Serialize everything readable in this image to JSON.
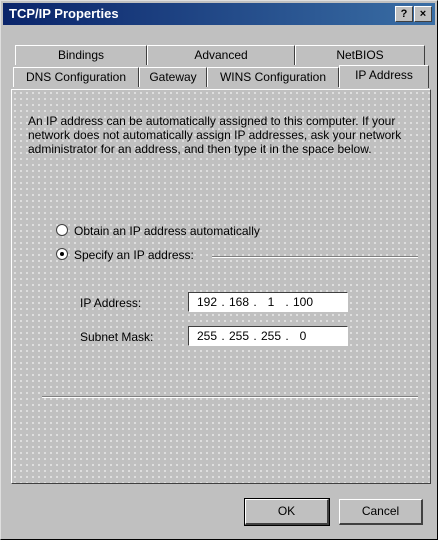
{
  "window": {
    "title": "TCP/IP Properties",
    "help_glyph": "?",
    "close_glyph": "×"
  },
  "tabs": {
    "row1": [
      "Bindings",
      "Advanced",
      "NetBIOS"
    ],
    "row2": [
      "DNS Configuration",
      "Gateway",
      "WINS Configuration",
      "IP Address"
    ],
    "active": "IP Address"
  },
  "description": "An IP address can be automatically assigned to this computer. If your network does not automatically assign IP addresses, ask your network administrator for an address, and then type it in the space below.",
  "options": {
    "obtain_auto": "Obtain an IP address automatically",
    "specify": "Specify an IP address:",
    "selected": "specify"
  },
  "fields": {
    "ip_address": {
      "label": "IP Address:",
      "octets": [
        "192",
        "168",
        "1",
        "100"
      ]
    },
    "subnet_mask": {
      "label": "Subnet Mask:",
      "octets": [
        "255",
        "255",
        "255",
        "0"
      ]
    }
  },
  "buttons": {
    "ok": "OK",
    "cancel": "Cancel"
  }
}
